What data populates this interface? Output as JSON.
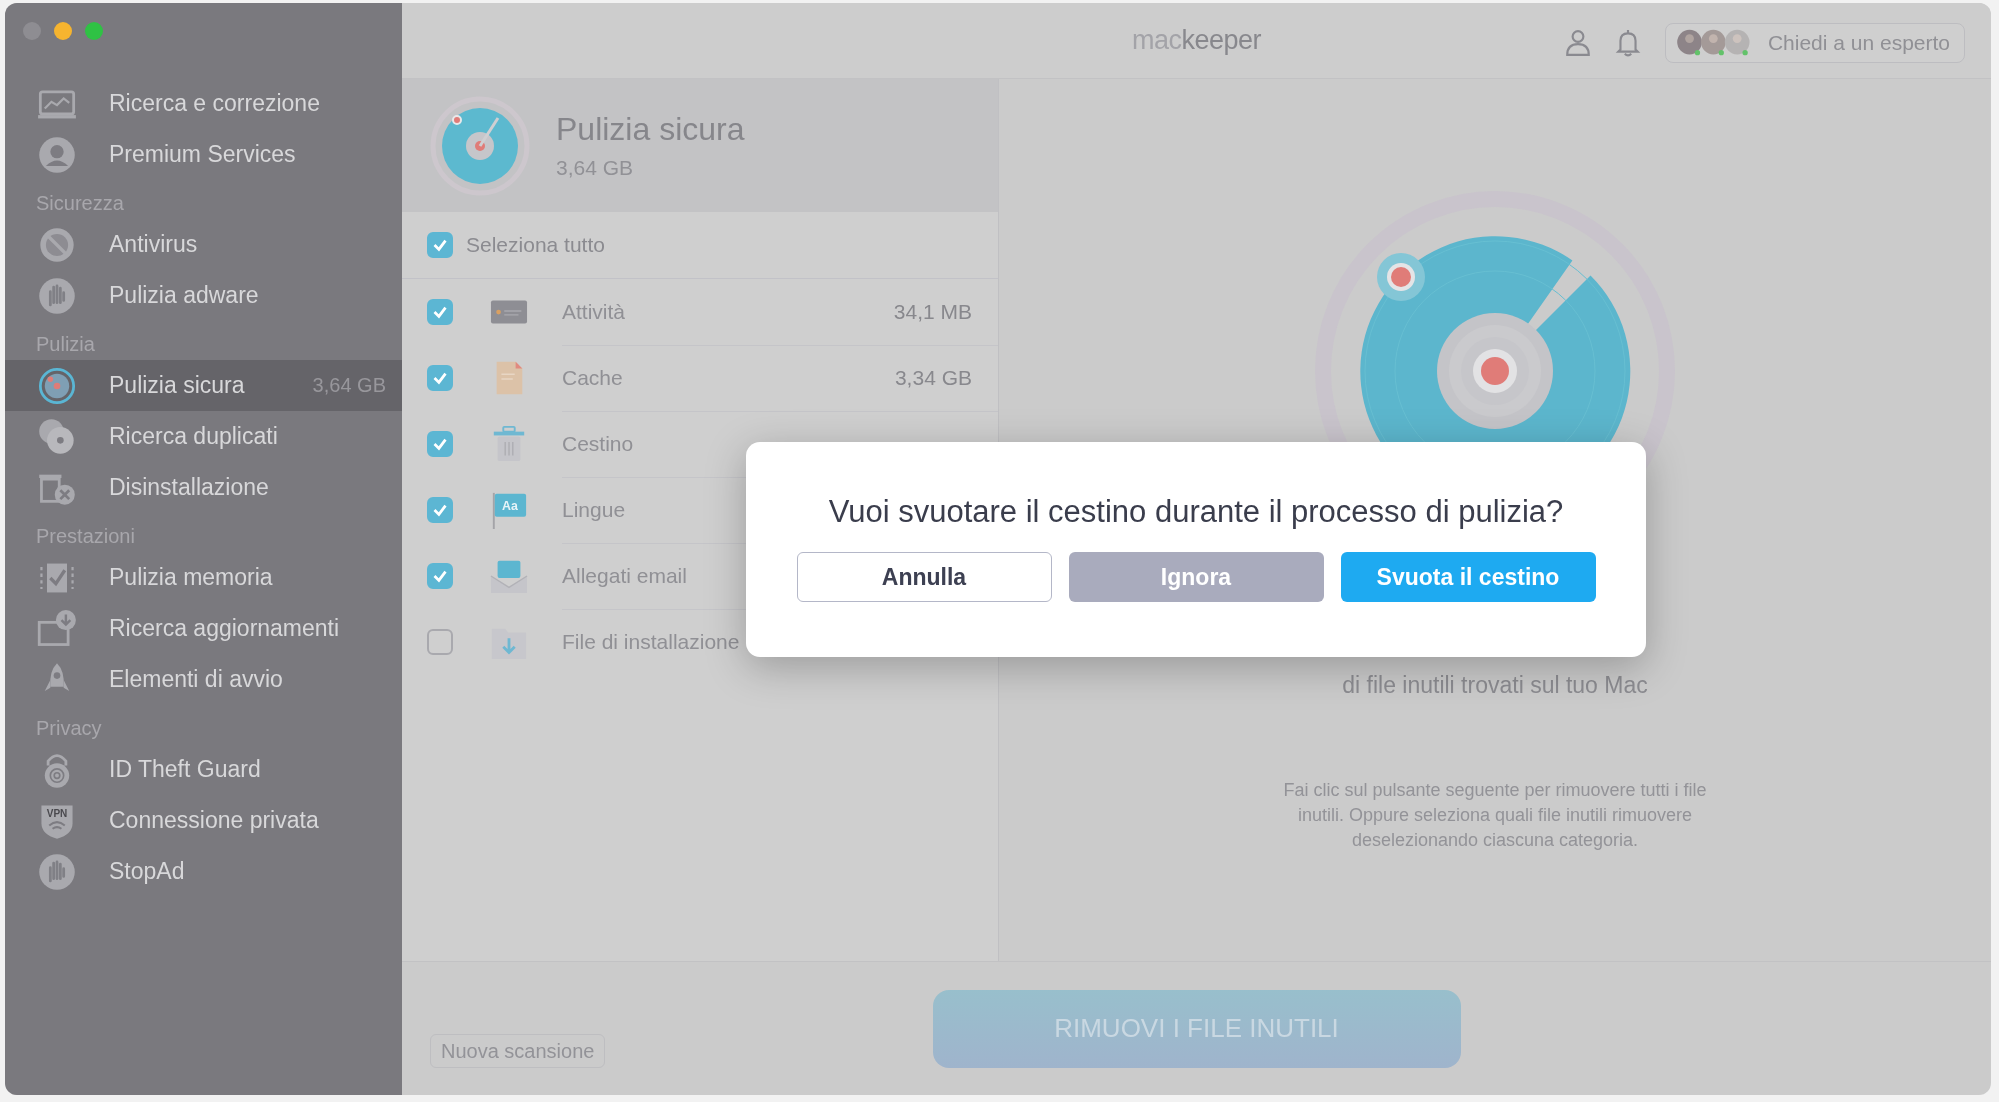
{
  "topbar": {
    "logo_light": "mac",
    "logo_dark": "keeper",
    "expert_button": "Chiedi a un esperto"
  },
  "sidebar": {
    "items": [
      {
        "label": "Ricerca e correzione",
        "selected": false
      },
      {
        "label": "Premium Services",
        "selected": false
      }
    ],
    "sections": [
      {
        "title": "Sicurezza",
        "items": [
          {
            "label": "Antivirus",
            "selected": false
          },
          {
            "label": "Pulizia adware",
            "selected": false
          }
        ]
      },
      {
        "title": "Pulizia",
        "items": [
          {
            "label": "Pulizia sicura",
            "selected": true,
            "badge": "3,64 GB"
          },
          {
            "label": "Ricerca duplicati",
            "selected": false
          },
          {
            "label": "Disinstallazione",
            "selected": false
          }
        ]
      },
      {
        "title": "Prestazioni",
        "items": [
          {
            "label": "Pulizia memoria",
            "selected": false
          },
          {
            "label": "Ricerca aggiornamenti",
            "selected": false
          },
          {
            "label": "Elementi di avvio",
            "selected": false
          }
        ]
      },
      {
        "title": "Privacy",
        "items": [
          {
            "label": "ID Theft Guard",
            "selected": false
          },
          {
            "label": "Connessione privata",
            "selected": false,
            "icon_text": "VPN"
          },
          {
            "label": "StopAd",
            "selected": false
          }
        ]
      }
    ]
  },
  "panel": {
    "title": "Pulizia sicura",
    "size": "3,64 GB"
  },
  "select_all": {
    "label": "Seleziona tutto",
    "checked": true
  },
  "categories": [
    {
      "label": "Attività",
      "size": "34,1 MB",
      "checked": true
    },
    {
      "label": "Cache",
      "size": "3,34 GB",
      "checked": true
    },
    {
      "label": "Cestino",
      "checked": true
    },
    {
      "label": "Lingue",
      "checked": true,
      "icon_text": "Aa"
    },
    {
      "label": "Allegati email",
      "checked": true
    },
    {
      "label": "File di installazione",
      "checked": false
    }
  ],
  "summary": {
    "caption": "di file inutili trovati sul tuo Mac",
    "hint": "Fai clic sul pulsante seguente per rimuovere tutti i file inutili. Oppure seleziona quali file inutili rimuovere deselezionando ciascuna categoria."
  },
  "bottom": {
    "rescan_button": "Nuova scansione",
    "remove_button": "RIMUOVI I FILE INUTILI"
  },
  "dialog": {
    "question": "Vuoi svuotare il cestino durante il processo di pulizia?",
    "buttons": [
      {
        "label": "Annulla",
        "kind": "secondary"
      },
      {
        "label": "Ignora",
        "kind": "neutral"
      },
      {
        "label": "Svuota il cestino",
        "kind": "primary"
      }
    ]
  }
}
